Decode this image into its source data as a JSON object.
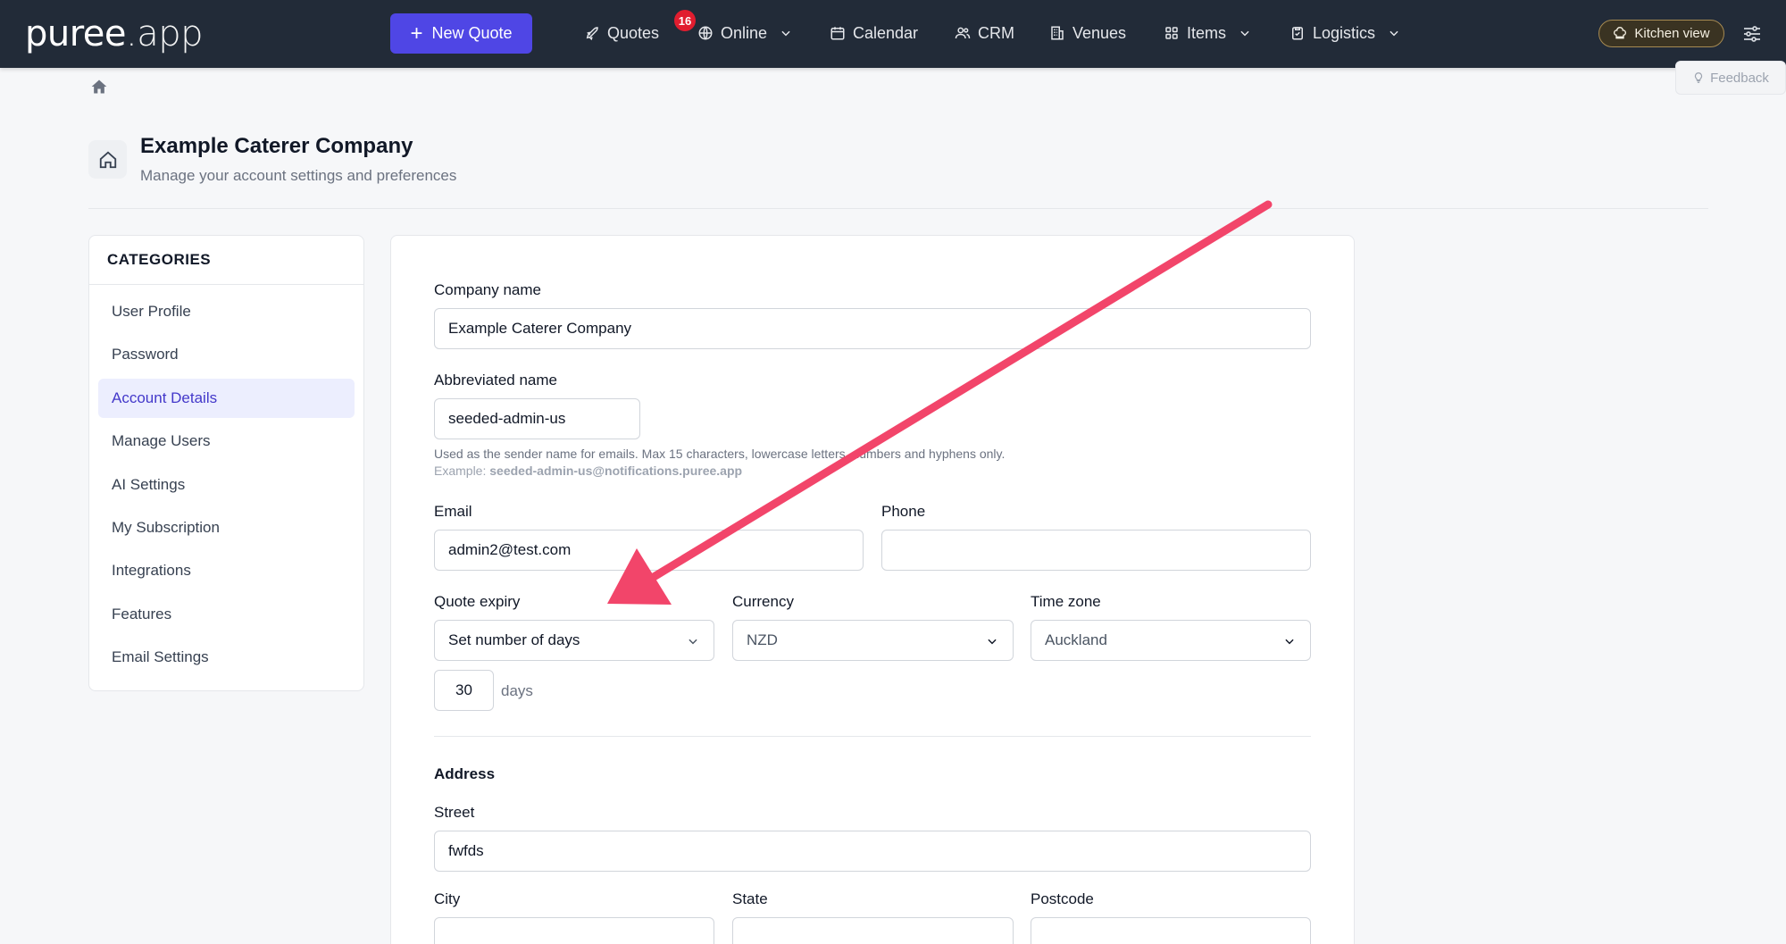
{
  "nav": {
    "logo_main": "puree",
    "logo_suffix": ".app",
    "new_quote": "New Quote",
    "quotes": "Quotes",
    "quotes_badge": "16",
    "online": "Online",
    "calendar": "Calendar",
    "crm": "CRM",
    "venues": "Venues",
    "items": "Items",
    "logistics": "Logistics",
    "kitchen_view": "Kitchen view",
    "feedback": "Feedback"
  },
  "header": {
    "title": "Example Caterer Company",
    "subtitle": "Manage your account settings and preferences"
  },
  "sidebar": {
    "title": "CATEGORIES",
    "items": [
      {
        "label": "User Profile",
        "active": false
      },
      {
        "label": "Password",
        "active": false
      },
      {
        "label": "Account Details",
        "active": true
      },
      {
        "label": "Manage Users",
        "active": false
      },
      {
        "label": "AI Settings",
        "active": false
      },
      {
        "label": "My Subscription",
        "active": false
      },
      {
        "label": "Integrations",
        "active": false
      },
      {
        "label": "Features",
        "active": false
      },
      {
        "label": "Email Settings",
        "active": false
      }
    ]
  },
  "form": {
    "company_name_label": "Company name",
    "company_name_value": "Example Caterer Company",
    "abbrev_label": "Abbreviated name",
    "abbrev_value": "seeded-admin-us",
    "abbrev_help": "Used as the sender name for emails. Max 15 characters, lowercase letters, numbers and hyphens only.",
    "abbrev_example_prefix": "Example: ",
    "abbrev_example_value": "seeded-admin-us@notifications.puree.app",
    "email_label": "Email",
    "email_value": "admin2@test.com",
    "phone_label": "Phone",
    "phone_value": "",
    "quote_expiry_label": "Quote expiry",
    "quote_expiry_value": "Set number of days",
    "currency_label": "Currency",
    "currency_value": "NZD",
    "timezone_label": "Time zone",
    "timezone_value": "Auckland",
    "days_value": "30",
    "days_unit": "days",
    "address_title": "Address",
    "street_label": "Street",
    "street_value": "fwfds",
    "city_label": "City",
    "city_value": "",
    "state_label": "State",
    "state_value": "",
    "postcode_label": "Postcode",
    "postcode_value": ""
  },
  "colors": {
    "nav_bg": "#222b38",
    "primary": "#4f46e5",
    "badge": "#e11d2f",
    "annotation_arrow": "#f2456a",
    "active_item_bg": "#eceefe"
  }
}
